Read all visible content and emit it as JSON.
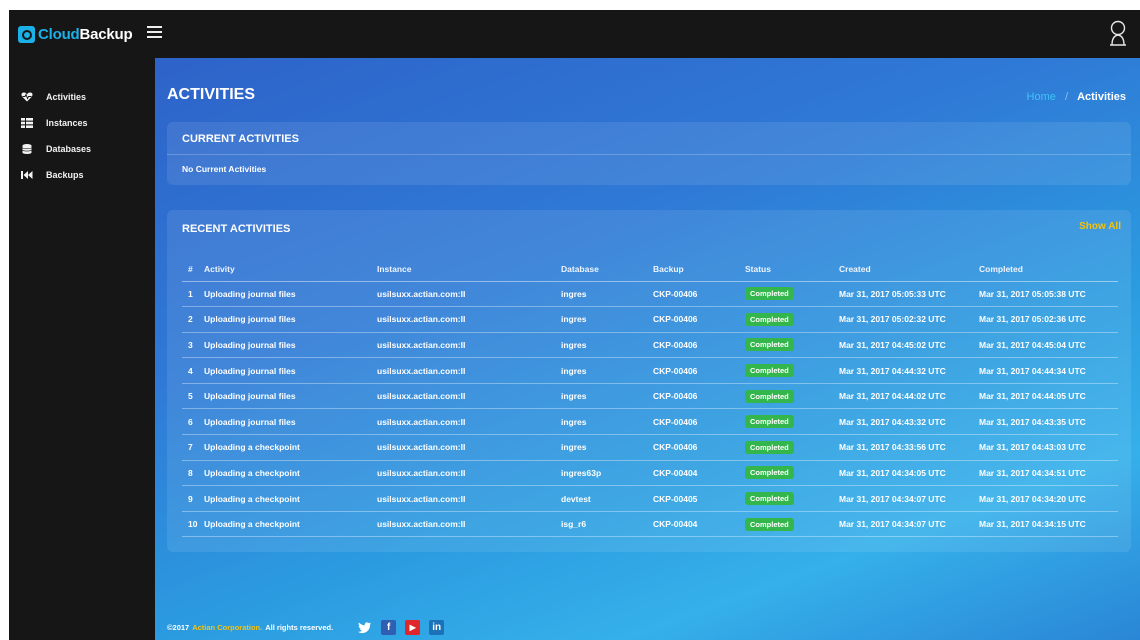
{
  "brand": {
    "part1": "Cloud",
    "part2": "Backup"
  },
  "sidebar": {
    "items": [
      {
        "label": "Activities",
        "icon": "heartbeat-icon"
      },
      {
        "label": "Instances",
        "icon": "server-icon"
      },
      {
        "label": "Databases",
        "icon": "database-icon"
      },
      {
        "label": "Backups",
        "icon": "backward-icon"
      }
    ]
  },
  "page": {
    "title": "ACTIVITIES",
    "breadcrumb": {
      "home": "Home",
      "separator": "/",
      "current": "Activities"
    }
  },
  "current_activities": {
    "title": "CURRENT ACTIVITIES",
    "empty_text": "No Current Activities"
  },
  "recent_activities": {
    "title": "RECENT ACTIVITIES",
    "show_all": "Show All",
    "columns": [
      "#",
      "Activity",
      "Instance",
      "Database",
      "Backup",
      "Status",
      "Created",
      "Completed"
    ],
    "rows": [
      [
        "1",
        "Uploading journal files",
        "usilsuxx.actian.com:II",
        "ingres",
        "CKP-00406",
        "Completed",
        "Mar 31, 2017 05:05:33 UTC",
        "Mar 31, 2017 05:05:38 UTC"
      ],
      [
        "2",
        "Uploading journal files",
        "usilsuxx.actian.com:II",
        "ingres",
        "CKP-00406",
        "Completed",
        "Mar 31, 2017 05:02:32 UTC",
        "Mar 31, 2017 05:02:36 UTC"
      ],
      [
        "3",
        "Uploading journal files",
        "usilsuxx.actian.com:II",
        "ingres",
        "CKP-00406",
        "Completed",
        "Mar 31, 2017 04:45:02 UTC",
        "Mar 31, 2017 04:45:04 UTC"
      ],
      [
        "4",
        "Uploading journal files",
        "usilsuxx.actian.com:II",
        "ingres",
        "CKP-00406",
        "Completed",
        "Mar 31, 2017 04:44:32 UTC",
        "Mar 31, 2017 04:44:34 UTC"
      ],
      [
        "5",
        "Uploading journal files",
        "usilsuxx.actian.com:II",
        "ingres",
        "CKP-00406",
        "Completed",
        "Mar 31, 2017 04:44:02 UTC",
        "Mar 31, 2017 04:44:05 UTC"
      ],
      [
        "6",
        "Uploading journal files",
        "usilsuxx.actian.com:II",
        "ingres",
        "CKP-00406",
        "Completed",
        "Mar 31, 2017 04:43:32 UTC",
        "Mar 31, 2017 04:43:35 UTC"
      ],
      [
        "7",
        "Uploading a checkpoint",
        "usilsuxx.actian.com:II",
        "ingres",
        "CKP-00406",
        "Completed",
        "Mar 31, 2017 04:33:56 UTC",
        "Mar 31, 2017 04:43:03 UTC"
      ],
      [
        "8",
        "Uploading a checkpoint",
        "usilsuxx.actian.com:II",
        "ingres63p",
        "CKP-00404",
        "Completed",
        "Mar 31, 2017 04:34:05 UTC",
        "Mar 31, 2017 04:34:51 UTC"
      ],
      [
        "9",
        "Uploading a checkpoint",
        "usilsuxx.actian.com:II",
        "devtest",
        "CKP-00405",
        "Completed",
        "Mar 31, 2017 04:34:07 UTC",
        "Mar 31, 2017 04:34:20 UTC"
      ],
      [
        "10",
        "Uploading a checkpoint",
        "usilsuxx.actian.com:II",
        "isg_r6",
        "CKP-00404",
        "Completed",
        "Mar 31, 2017 04:34:07 UTC",
        "Mar 31, 2017 04:34:15 UTC"
      ]
    ]
  },
  "footer": {
    "copyright": "©2017",
    "company": "Actian Corporation.",
    "rights": "All rights reserved.",
    "socials": [
      {
        "name": "twitter-icon",
        "glyph": "🐦"
      },
      {
        "name": "facebook-icon",
        "glyph": "f"
      },
      {
        "name": "youtube-icon",
        "glyph": "▶"
      },
      {
        "name": "linkedin-icon",
        "glyph": "in"
      }
    ]
  },
  "colors": {
    "accent": "#1cb0e8",
    "status_completed": "#33b74c",
    "show_all": "#f4c20d",
    "dark": "#161616"
  }
}
